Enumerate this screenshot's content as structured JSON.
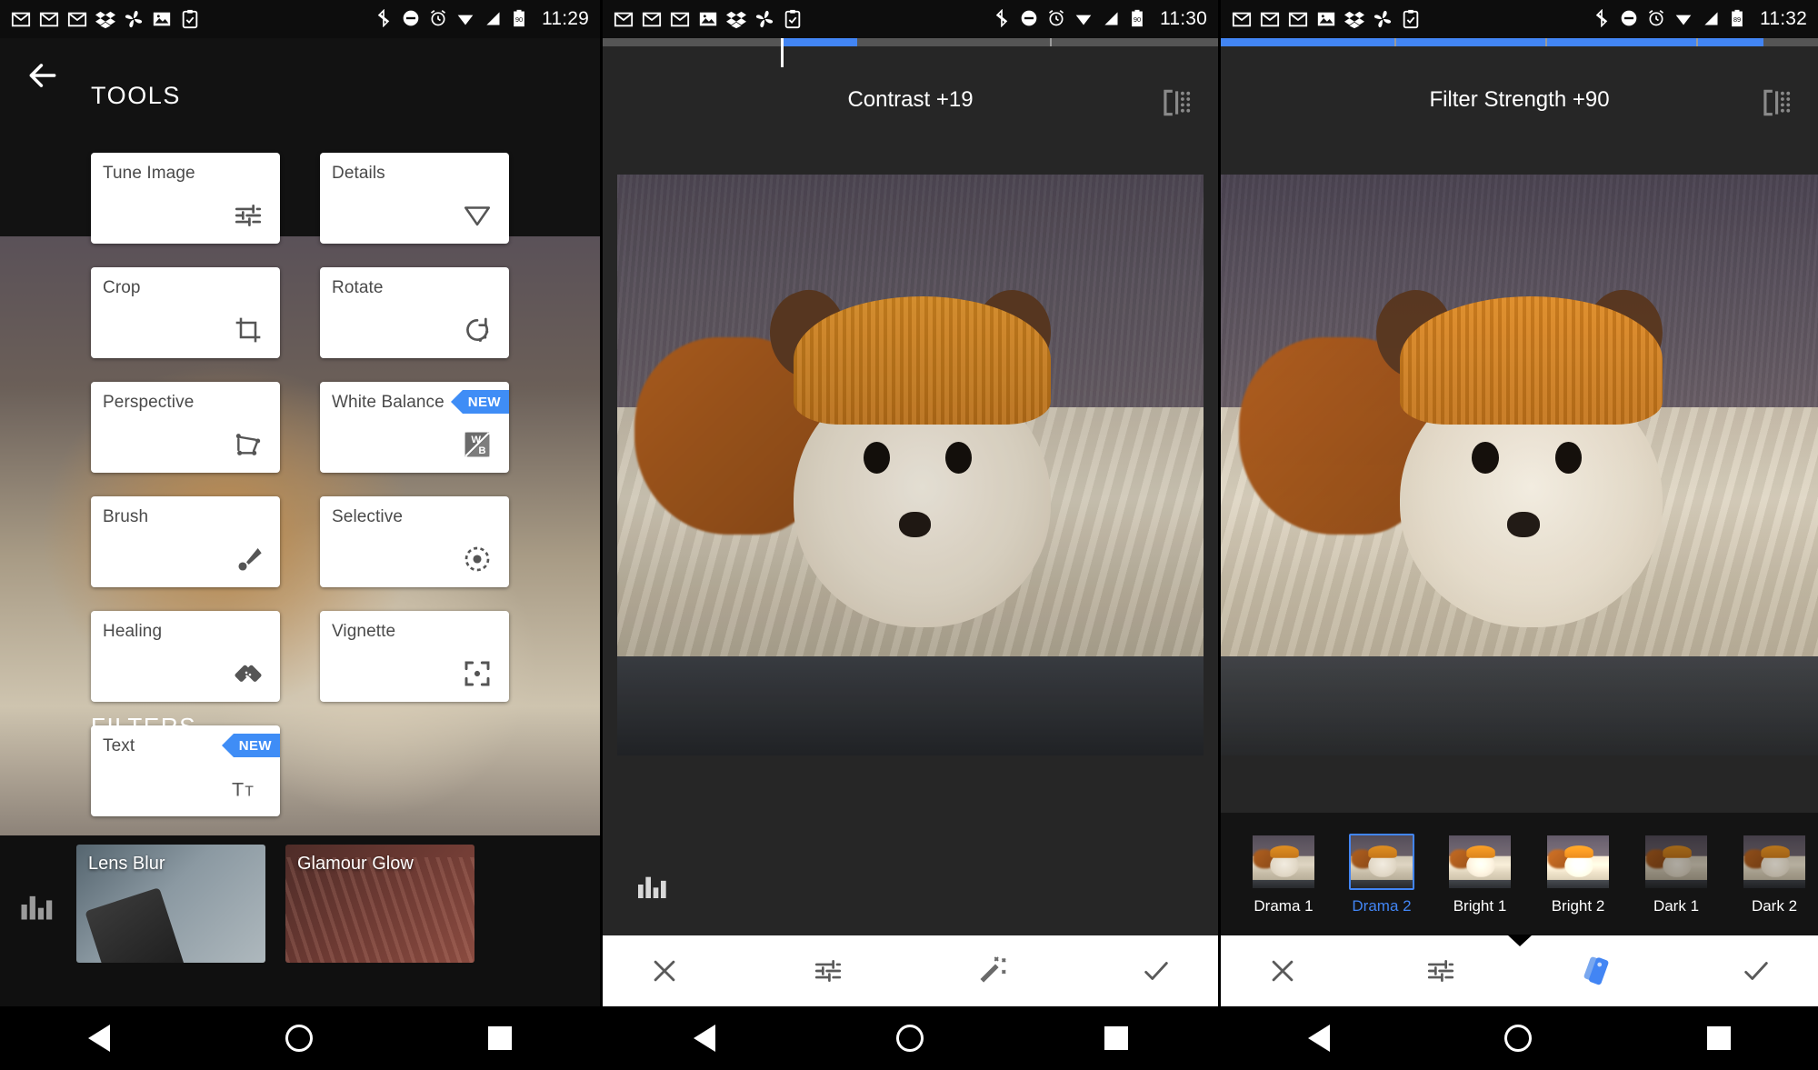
{
  "app": "Snapseed photo editor",
  "panels": [
    {
      "id": "tools-panel",
      "status": {
        "time": "11:29",
        "battery": "90",
        "icons": [
          "gmail-icon",
          "gmail-icon",
          "gmail-icon",
          "dropbox-icon",
          "photos-icon",
          "image-icon",
          "clipboard-check-icon",
          "bluetooth-icon",
          "do-not-disturb-icon",
          "alarm-icon",
          "wifi-icon",
          "signal-icon",
          "battery-icon"
        ]
      },
      "back_label": "Back",
      "tools_heading": "TOOLS",
      "filters_heading": "FILTERS",
      "tools": [
        {
          "label": "Tune Image",
          "icon": "sliders-icon",
          "badge": null
        },
        {
          "label": "Details",
          "icon": "triangle-icon",
          "badge": null
        },
        {
          "label": "Crop",
          "icon": "crop-icon",
          "badge": null
        },
        {
          "label": "Rotate",
          "icon": "rotate-icon",
          "badge": null
        },
        {
          "label": "Perspective",
          "icon": "perspective-icon",
          "badge": null
        },
        {
          "label": "White Balance",
          "icon": "white-balance-icon",
          "badge": "NEW"
        },
        {
          "label": "Brush",
          "icon": "brush-icon",
          "badge": null
        },
        {
          "label": "Selective",
          "icon": "selective-icon",
          "badge": null
        },
        {
          "label": "Healing",
          "icon": "healing-icon",
          "badge": null
        },
        {
          "label": "Vignette",
          "icon": "vignette-icon",
          "badge": null
        },
        {
          "label": "Text",
          "icon": "text-icon",
          "badge": "NEW"
        }
      ],
      "filters": [
        {
          "label": "Lens Blur"
        },
        {
          "label": "Glamour Glow"
        }
      ]
    },
    {
      "id": "contrast-panel",
      "status": {
        "time": "11:30",
        "battery": "90"
      },
      "title": "Contrast +19",
      "slider": {
        "value": 19,
        "fill_percent": 30,
        "handle_percent": 30,
        "segments": 4
      },
      "compare_icon": "compare-icon",
      "histogram_icon": "histogram-icon",
      "toolbar": [
        {
          "label": "Cancel",
          "icon": "close-icon",
          "active": false
        },
        {
          "label": "Adjustments",
          "icon": "sliders-icon",
          "active": false
        },
        {
          "label": "Auto",
          "icon": "magic-wand-icon",
          "active": false
        },
        {
          "label": "Apply",
          "icon": "check-icon",
          "active": false
        }
      ]
    },
    {
      "id": "filter-strength-panel",
      "status": {
        "time": "11:32",
        "battery": "89"
      },
      "title": "Filter Strength +90",
      "slider": {
        "value": 90,
        "fill_percent": 90,
        "segments": 4
      },
      "compare_icon": "compare-icon",
      "presets": [
        {
          "label": "Drama 1",
          "selected": false
        },
        {
          "label": "Drama 2",
          "selected": true
        },
        {
          "label": "Bright 1",
          "selected": false
        },
        {
          "label": "Bright 2",
          "selected": false
        },
        {
          "label": "Dark 1",
          "selected": false
        },
        {
          "label": "Dark 2",
          "selected": false
        }
      ],
      "toolbar": [
        {
          "label": "Cancel",
          "icon": "close-icon",
          "active": false
        },
        {
          "label": "Tune",
          "icon": "sliders-icon",
          "active": false
        },
        {
          "label": "Presets",
          "icon": "filter-cards-icon",
          "active": true
        },
        {
          "label": "Apply",
          "icon": "check-icon",
          "active": false
        }
      ]
    }
  ],
  "navbar": {
    "back": "back-triangle",
    "home": "home-circle",
    "recents": "recents-square"
  },
  "colors": {
    "accent": "#4285f4",
    "badge": "#3f8df6",
    "card": "#ffffff",
    "bar_bg": "#0d0d0d"
  }
}
